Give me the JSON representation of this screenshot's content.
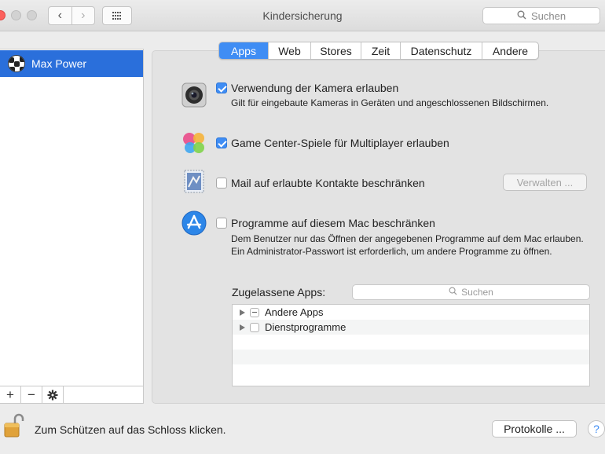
{
  "window": {
    "title": "Kindersicherung",
    "search_placeholder": "Suchen"
  },
  "sidebar": {
    "users": [
      {
        "name": "Max Power",
        "avatar_icon": "soccer-ball-icon"
      }
    ],
    "buttons": {
      "add": "+",
      "remove": "−",
      "settings": "✱"
    }
  },
  "tabs": [
    {
      "label": "Apps",
      "active": true
    },
    {
      "label": "Web",
      "active": false
    },
    {
      "label": "Stores",
      "active": false
    },
    {
      "label": "Zeit",
      "active": false
    },
    {
      "label": "Datenschutz",
      "active": false
    },
    {
      "label": "Andere",
      "active": false
    }
  ],
  "options": {
    "camera": {
      "label": "Verwendung der Kamera erlauben",
      "description": "Gilt für eingebaute Kameras in Geräten und angeschlossenen Bildschirmen.",
      "checked": true
    },
    "game_center": {
      "label": "Game Center-Spiele für Multiplayer erlauben",
      "checked": true
    },
    "mail": {
      "label": "Mail auf erlaubte Kontakte beschränken",
      "checked": false,
      "button": "Verwalten ..."
    },
    "programs": {
      "label": "Programme auf diesem Mac beschränken",
      "description": "Dem Benutzer nur das Öffnen der angegebenen Programme auf dem Mac erlauben. Ein Administrator-Passwort ist erforderlich, um andere Programme zu öffnen.",
      "checked": false
    }
  },
  "allowed_apps": {
    "label": "Zugelassene Apps:",
    "search_placeholder": "Suchen",
    "items": [
      {
        "name": "Andere Apps",
        "state": "mixed"
      },
      {
        "name": "Dienstprogramme",
        "state": "unchecked"
      }
    ]
  },
  "footer": {
    "lock_text": "Zum Schützen auf das Schloss klicken.",
    "logs_button": "Protokolle ...",
    "help": "?"
  },
  "colors": {
    "accent": "#3f8df4",
    "selection": "#2a6fdb",
    "close": "#fc605c"
  }
}
